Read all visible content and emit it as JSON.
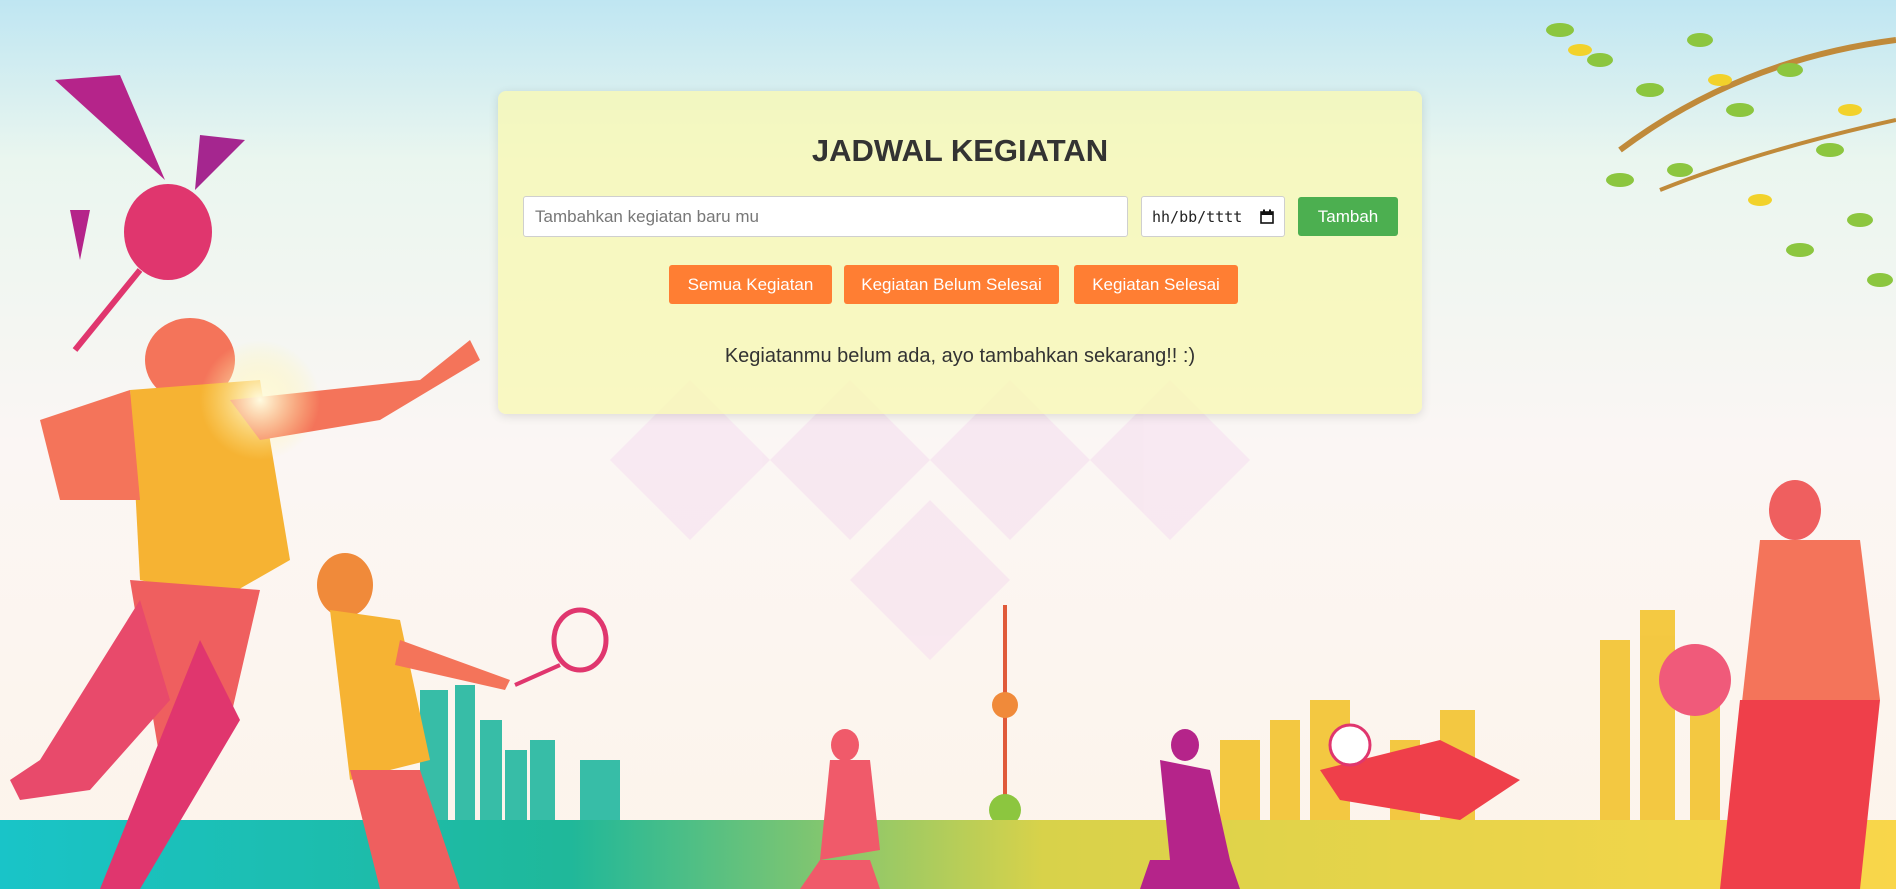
{
  "header": {
    "title": "JADWAL KEGIATAN"
  },
  "form": {
    "task_placeholder": "Tambahkan kegiatan baru mu",
    "task_value": "",
    "date_placeholder": "hh/bb/tttt",
    "add_label": "Tambah"
  },
  "filters": [
    {
      "label": "Semua Kegiatan"
    },
    {
      "label": "Kegiatan Belum Selesai"
    },
    {
      "label": "Kegiatan Selesai"
    }
  ],
  "list": {
    "empty_message": "Kegiatanmu belum ada, ayo tambahkan sekarang!! :)"
  },
  "colors": {
    "card_bg": "#f9f8b4",
    "add_button": "#4caf50",
    "filter_button": "#ff7e33",
    "text": "#333333"
  },
  "icons": {
    "date_picker": "calendar-icon"
  }
}
